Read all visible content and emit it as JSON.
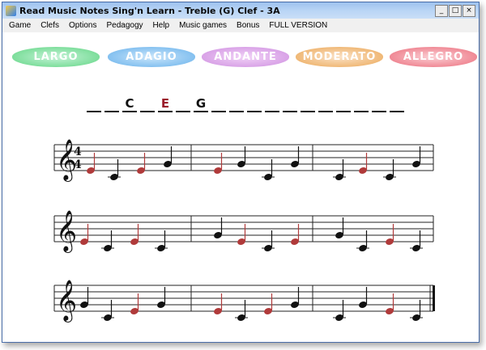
{
  "window": {
    "title": "Read Music Notes Sing'n Learn - Treble (G) Clef - 3A"
  },
  "menu": [
    "Game",
    "Clefs",
    "Options",
    "Pedagogy",
    "Help",
    "Music games",
    "Bonus",
    "FULL VERSION"
  ],
  "tempo_buttons": [
    "LARGO",
    "ADAGIO",
    "ANDANTE",
    "MODERATO",
    "ALLEGRO"
  ],
  "answer": {
    "slots": [
      "",
      "",
      "C",
      "",
      "E",
      "",
      "G",
      "",
      "",
      "",
      "",
      "",
      "",
      "",
      "",
      "",
      "",
      ""
    ],
    "highlight_index": 4
  },
  "time_signature": {
    "top": "4",
    "bottom": "4"
  },
  "notes": {
    "line1": [
      [
        "E",
        "C",
        "E",
        "G"
      ],
      [
        "E",
        "G",
        "C",
        "G"
      ],
      [
        "C",
        "E",
        "C",
        "G"
      ]
    ],
    "line2": [
      [
        "E",
        "C",
        "E",
        "C"
      ],
      [
        "G",
        "E",
        "C",
        "E"
      ],
      [
        "G",
        "C",
        "E",
        "C"
      ]
    ],
    "line3": [
      [
        "G",
        "C",
        "E",
        "G"
      ],
      [
        "E",
        "C",
        "E",
        "G"
      ],
      [
        "C",
        "G",
        "E",
        "C"
      ]
    ]
  },
  "colors": {
    "note_black": "#111111",
    "note_red": "#b03a3a",
    "highlight_letter": "#9b1d2b",
    "titlebar": "#b9d5f5"
  }
}
